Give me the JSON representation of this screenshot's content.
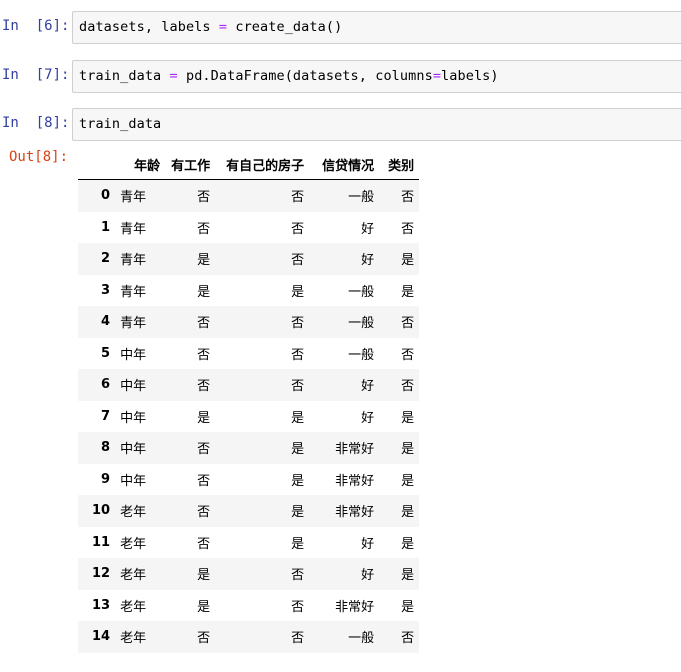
{
  "cells": [
    {
      "prompt": "In  [6]:",
      "code_parts": [
        {
          "t": "datasets, labels ",
          "c": "plain"
        },
        {
          "t": "=",
          "c": "op"
        },
        {
          "t": " create_data()",
          "c": "plain"
        }
      ]
    },
    {
      "prompt": "In  [7]:",
      "code_parts": [
        {
          "t": "train_data ",
          "c": "plain"
        },
        {
          "t": "=",
          "c": "op"
        },
        {
          "t": " pd.DataFrame(datasets, columns",
          "c": "plain"
        },
        {
          "t": "=",
          "c": "op"
        },
        {
          "t": "labels)",
          "c": "plain"
        }
      ]
    },
    {
      "prompt": "In  [8]:",
      "code_parts": [
        {
          "t": "train_data",
          "c": "plain"
        }
      ]
    }
  ],
  "output": {
    "prompt": "Out[8]:",
    "columns": [
      "年龄",
      "有工作",
      "有自己的房子",
      "信贷情况",
      "类别"
    ],
    "rows": [
      {
        "index": "0",
        "values": [
          "青年",
          "否",
          "否",
          "一般",
          "否"
        ]
      },
      {
        "index": "1",
        "values": [
          "青年",
          "否",
          "否",
          "好",
          "否"
        ]
      },
      {
        "index": "2",
        "values": [
          "青年",
          "是",
          "否",
          "好",
          "是"
        ]
      },
      {
        "index": "3",
        "values": [
          "青年",
          "是",
          "是",
          "一般",
          "是"
        ]
      },
      {
        "index": "4",
        "values": [
          "青年",
          "否",
          "否",
          "一般",
          "否"
        ]
      },
      {
        "index": "5",
        "values": [
          "中年",
          "否",
          "否",
          "一般",
          "否"
        ]
      },
      {
        "index": "6",
        "values": [
          "中年",
          "否",
          "否",
          "好",
          "否"
        ]
      },
      {
        "index": "7",
        "values": [
          "中年",
          "是",
          "是",
          "好",
          "是"
        ]
      },
      {
        "index": "8",
        "values": [
          "中年",
          "否",
          "是",
          "非常好",
          "是"
        ]
      },
      {
        "index": "9",
        "values": [
          "中年",
          "否",
          "是",
          "非常好",
          "是"
        ]
      },
      {
        "index": "10",
        "values": [
          "老年",
          "否",
          "是",
          "非常好",
          "是"
        ]
      },
      {
        "index": "11",
        "values": [
          "老年",
          "否",
          "是",
          "好",
          "是"
        ]
      },
      {
        "index": "12",
        "values": [
          "老年",
          "是",
          "否",
          "好",
          "是"
        ]
      },
      {
        "index": "13",
        "values": [
          "老年",
          "是",
          "否",
          "非常好",
          "是"
        ]
      },
      {
        "index": "14",
        "values": [
          "老年",
          "否",
          "否",
          "一般",
          "否"
        ]
      }
    ]
  },
  "colors": {
    "in_prompt": "#303f9f",
    "out_prompt": "#d84315",
    "operator": "#aa22ff",
    "input_bg": "#f7f7f7",
    "row_stripe": "#f5f5f5"
  }
}
